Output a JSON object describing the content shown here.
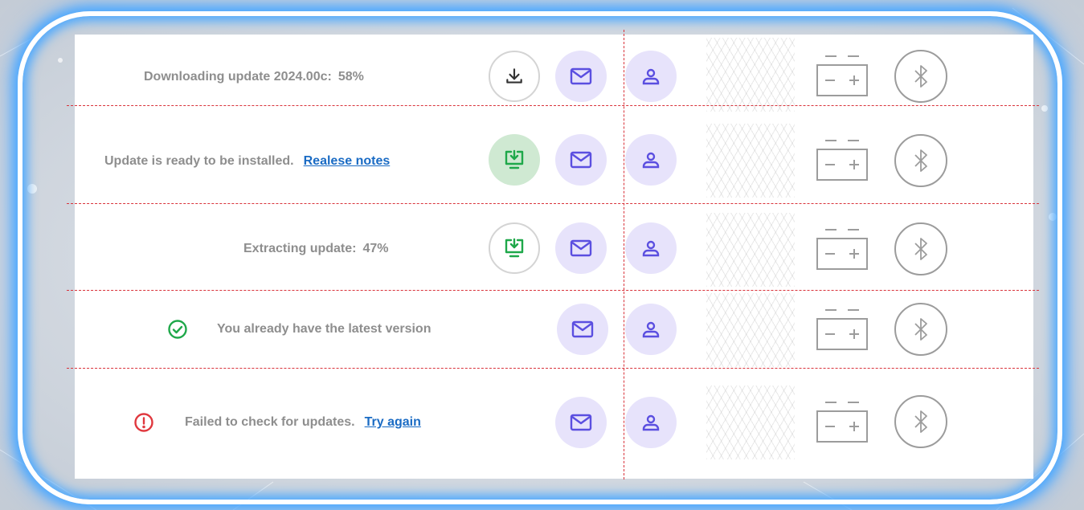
{
  "rows": [
    {
      "status_text": "Downloading update 2024.00c:",
      "progress": "58%"
    },
    {
      "status_text": "Update is ready to be installed.",
      "link": "Realese notes"
    },
    {
      "status_text": "Extracting update:",
      "progress": "47%"
    },
    {
      "status_text": "You already have the latest version"
    },
    {
      "status_text": "Failed to check for updates.",
      "link": "Try again"
    }
  ],
  "icons": {
    "download": "download-icon",
    "install": "install-update-icon",
    "mail": "mail-icon",
    "user": "user-icon",
    "battery": "battery-icon",
    "bluetooth": "bluetooth-icon",
    "success": "check-circle-icon",
    "error": "error-circle-icon"
  },
  "colors": {
    "link": "#1a6bc4",
    "text": "#8e8e8e",
    "accent_lavender": "#e7e3fb",
    "icon_purple": "#5b4fe0",
    "success_green": "#1fa84a",
    "error_red": "#e0383e",
    "ready_green_bg": "#cfe9d2",
    "divider_red": "#d9333b"
  }
}
